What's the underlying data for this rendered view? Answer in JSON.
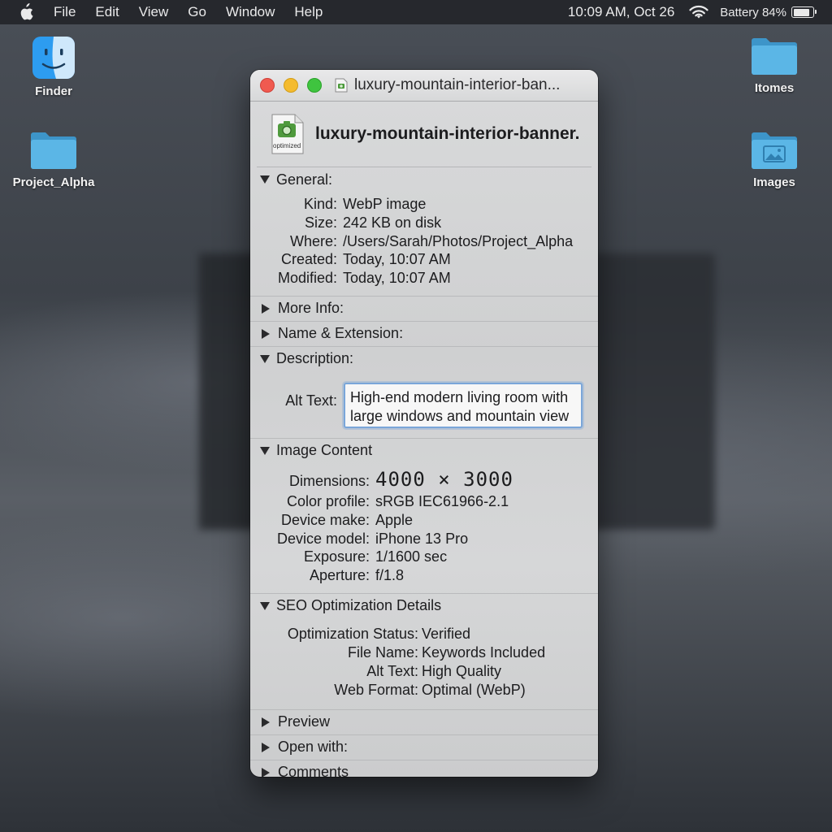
{
  "menubar": {
    "items": [
      "File",
      "Edit",
      "View",
      "Go",
      "Window",
      "Help"
    ],
    "clock": "10:09 AM, Oct 26",
    "battery_label": "Battery 84%",
    "battery_level": 0.84
  },
  "desktop": {
    "icons": [
      {
        "label": "Finder",
        "icon": "finder-icon"
      },
      {
        "label": "Project_Alpha",
        "icon": "folder-icon"
      },
      {
        "label": "Itomes",
        "icon": "folder-icon"
      },
      {
        "label": "Images",
        "icon": "images-folder-icon"
      }
    ]
  },
  "info_window": {
    "title": "luxury-mountain-interior-ban...",
    "file_name": "luxury-mountain-interior-banner.",
    "thumb_badge": "optimized",
    "sections": {
      "general": {
        "label": "General:",
        "rows": [
          {
            "k": "Kind:",
            "v": "WebP image"
          },
          {
            "k": "Size:",
            "v": "242 KB on disk"
          },
          {
            "k": "Where:",
            "v": "/Users/Sarah/Photos/Project_Alpha"
          },
          {
            "k": "Created:",
            "v": "Today, 10:07 AM"
          },
          {
            "k": "Modified:",
            "v": "Today, 10:07 AM"
          }
        ]
      },
      "more_info": {
        "label": "More Info:"
      },
      "name_extension": {
        "label": "Name & Extension:"
      },
      "description": {
        "label": "Description:",
        "alt_label": "Alt Text:",
        "alt_value": "High-end modern living room with large windows and mountain view"
      },
      "image_content": {
        "label": "Image Content",
        "dimensions_label": "Dimensions:",
        "dimensions_value": "4000 × 3000",
        "rows": [
          {
            "k": "Color profile:",
            "v": "sRGB IEC61966-2.1"
          },
          {
            "k": "Device make:",
            "v": "Apple"
          },
          {
            "k": "Device model:",
            "v": "iPhone 13 Pro"
          },
          {
            "k": "Exposure:",
            "v": "1/1600 sec"
          },
          {
            "k": "Aperture:",
            "v": "f/1.8"
          }
        ]
      },
      "seo": {
        "label": "SEO Optimization Details",
        "rows": [
          {
            "k": "Optimization Status:",
            "v": "Verified"
          },
          {
            "k": "File Name:",
            "v": "Keywords Included"
          },
          {
            "k": "Alt Text:",
            "v": "High Quality"
          },
          {
            "k": "Web Format:",
            "v": "Optimal (WebP)"
          }
        ]
      },
      "preview": {
        "label": "Preview"
      },
      "open_with": {
        "label": "Open with:"
      },
      "comments": {
        "label": "Comments"
      }
    }
  },
  "colors": {
    "traffic_red": "#f05a50",
    "traffic_yellow": "#f4bb2f",
    "traffic_green": "#3fc43f",
    "folder_blue": "#5bb6e6",
    "focus_ring": "#7aa6d9"
  }
}
